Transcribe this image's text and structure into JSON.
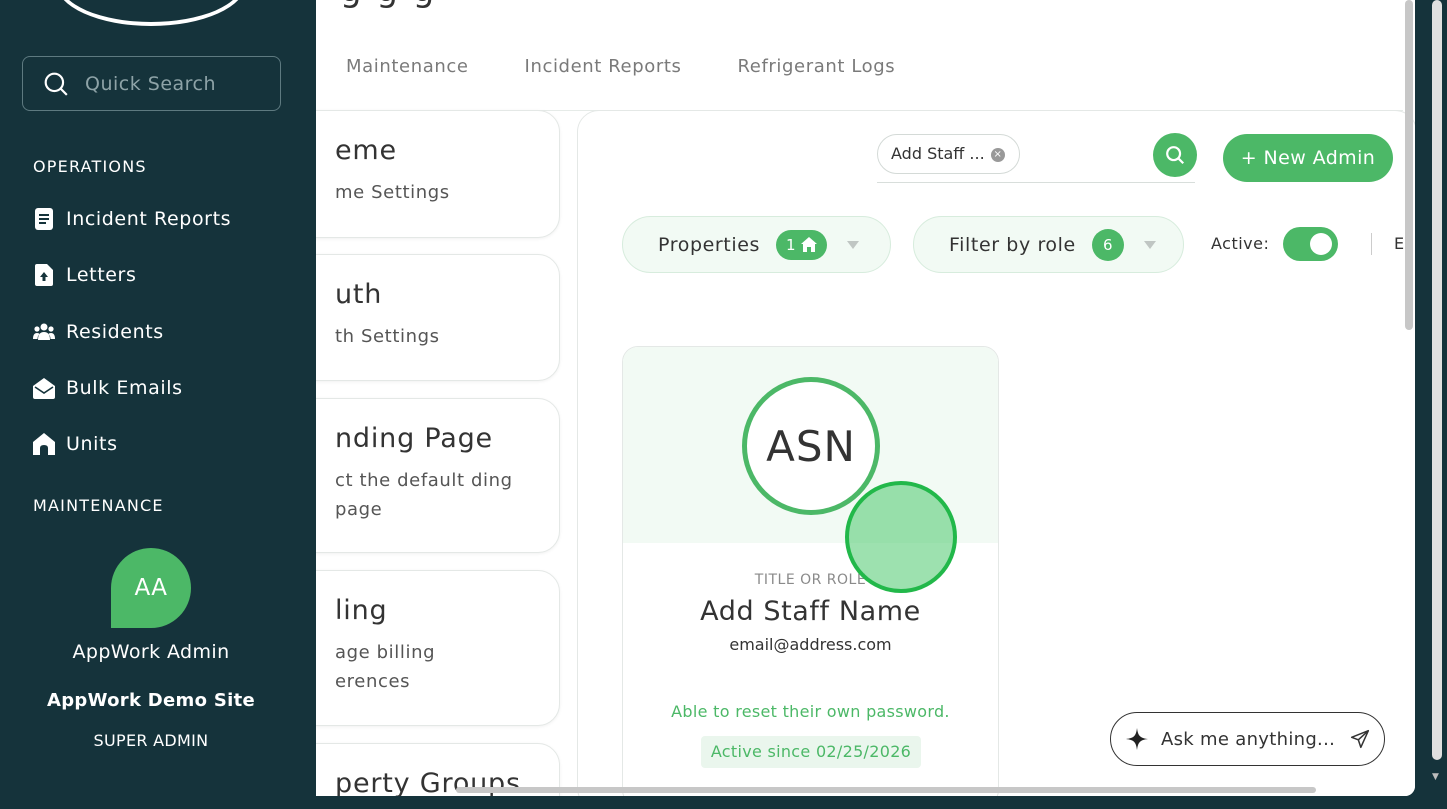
{
  "page": {
    "title_fragment": "g                g                          g",
    "tabs": [
      "Maintenance",
      "Incident Reports",
      "Refrigerant Logs"
    ]
  },
  "settings_cards": [
    {
      "title": "eme",
      "desc": "me Settings"
    },
    {
      "title": "uth",
      "desc": "th Settings"
    },
    {
      "title": "nding Page",
      "desc": "ct the default ding page"
    },
    {
      "title": "ling",
      "desc": "age billing erences"
    },
    {
      "title": "perty Groups",
      "desc": ""
    }
  ],
  "toolbar": {
    "search_chip": "Add Staff ...",
    "new_admin": "+ New Admin",
    "properties_label": "Properties",
    "properties_count": "1",
    "role_label": "Filter by role",
    "role_count": "6",
    "active_label": "Active:",
    "clipped": "E"
  },
  "staff_card": {
    "initials": "ASN",
    "role": "TITLE OR ROLE",
    "name": "Add Staff Name",
    "email": "email@address.com",
    "note": "Able to reset their own password.",
    "since": "Active since 02/25/2026"
  },
  "assistant": {
    "placeholder": "Ask me anything..."
  },
  "sidebar": {
    "search_placeholder": "Quick Search",
    "sections": [
      "OPERATIONS",
      "MAINTENANCE"
    ],
    "items": [
      {
        "label": "Incident Reports",
        "icon": "report-icon"
      },
      {
        "label": "Letters",
        "icon": "letter-upload-icon"
      },
      {
        "label": "Residents",
        "icon": "users-icon"
      },
      {
        "label": "Bulk Emails",
        "icon": "envelope-open-icon"
      },
      {
        "label": "Units",
        "icon": "home-icon"
      }
    ],
    "user": {
      "initials": "AA",
      "name": "AppWork Admin",
      "site": "AppWork Demo Site",
      "role": "SUPER ADMIN"
    }
  },
  "colors": {
    "brand_green": "#4cb867",
    "sidebar_bg": "#15333b",
    "light_green": "#f2faf4"
  }
}
